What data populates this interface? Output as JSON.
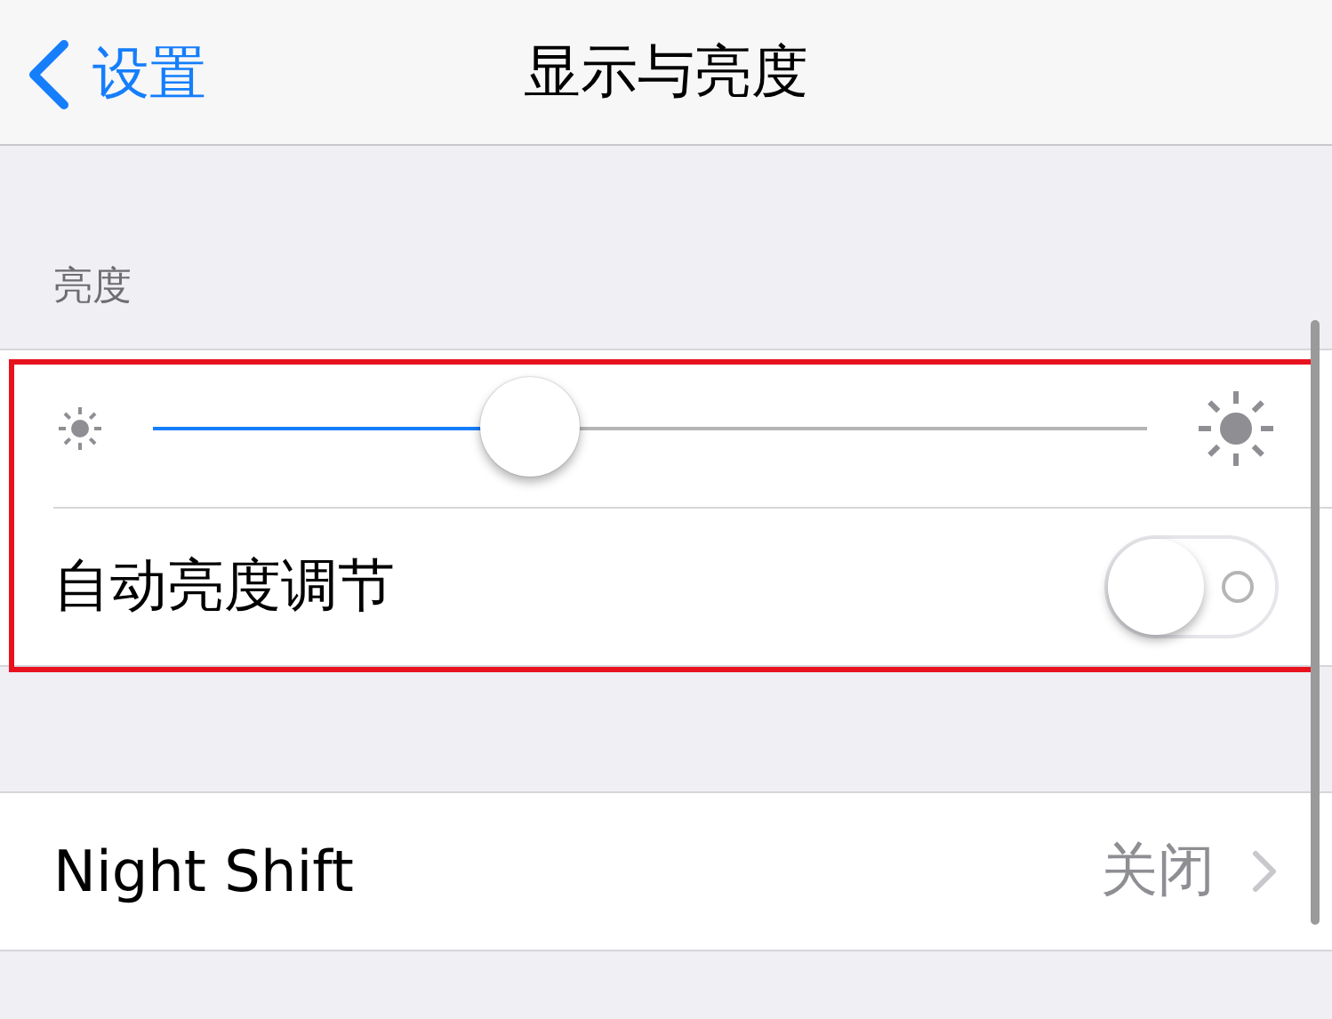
{
  "nav": {
    "back_label": "设置",
    "title": "显示与亮度"
  },
  "brightness": {
    "header": "亮度",
    "level": 0.38,
    "auto_label": "自动亮度调节",
    "auto_on": false
  },
  "night_shift": {
    "label": "Night Shift",
    "value": "关闭"
  }
}
